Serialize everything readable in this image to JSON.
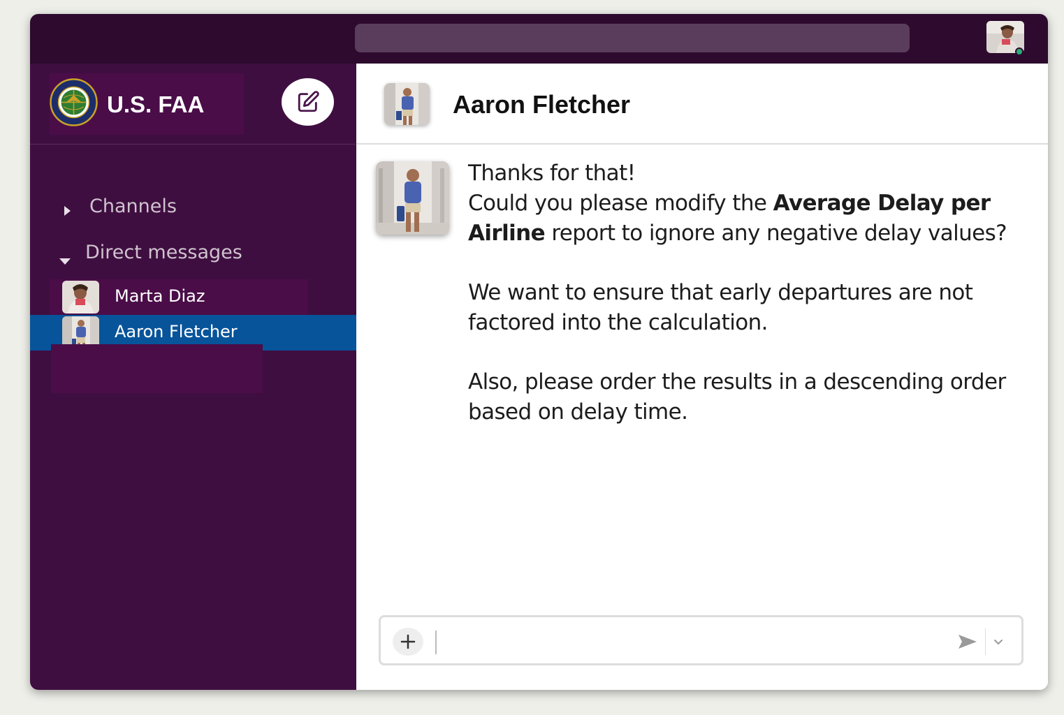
{
  "workspace": {
    "name": "U.S. FAA"
  },
  "sidebar": {
    "sections": [
      {
        "label": "Channels",
        "expanded": false
      },
      {
        "label": "Direct messages",
        "expanded": true
      }
    ],
    "direct_messages": [
      {
        "name": "Marta Diaz",
        "active": false
      },
      {
        "name": "Aaron Fletcher",
        "active": true
      }
    ]
  },
  "chat": {
    "title": "Aaron Fletcher",
    "message": {
      "line1": "Thanks for that!",
      "line2_pre": "Could you please modify the ",
      "line2_bold": "Average Delay per Airline",
      "line2_post": " report to ignore any negative delay values?",
      "para2": "We want to ensure that early departures are not factored into the calculation.",
      "para3": "Also, please order the results in a descending order based on delay time."
    }
  },
  "composer": {
    "value": "",
    "icons": [
      "plus-icon",
      "send-icon",
      "chevron-down-icon"
    ]
  },
  "colors": {
    "topbar": "#2d0a2e",
    "sidebar": "#3f0e40",
    "active_item": "#07549a",
    "status_online": "#2bac76"
  }
}
